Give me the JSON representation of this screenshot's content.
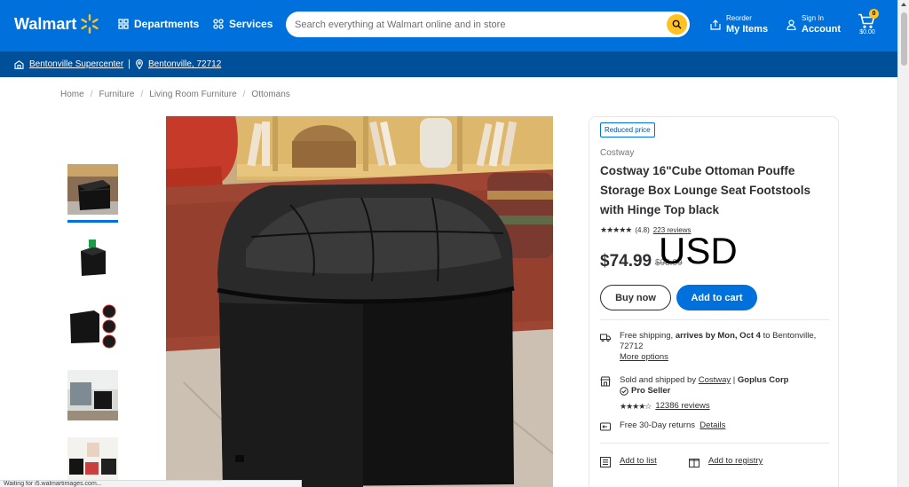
{
  "header": {
    "logo_text": "Walmart",
    "departments": "Departments",
    "services": "Services",
    "search_placeholder": "Search everything at Walmart online and in store",
    "reorder_small": "Reorder",
    "reorder_big": "My Items",
    "signin_small": "Sign In",
    "signin_big": "Account",
    "cart_count": "0",
    "cart_total": "$0.00",
    "colors": {
      "brand_blue": "#0071dc",
      "spark_yellow": "#ffc220",
      "dark_blue": "#004f9a"
    }
  },
  "subbar": {
    "store": "Bentonville Supercenter",
    "location": "Bentonville, 72712"
  },
  "breadcrumb": [
    "Home",
    "Furniture",
    "Living Room Furniture",
    "Ottomans"
  ],
  "product": {
    "badge": "Reduced price",
    "brand": "Costway",
    "title": "Costway 16\"Cube Ottoman Pouffe Storage Box Lounge Seat Footstools with Hinge Top black",
    "rating_value": "(4.8)",
    "review_count": "223 reviews",
    "price": "$74.99",
    "was_price": "$93.99",
    "overlay_text": "USD",
    "buy_now": "Buy now",
    "add_to_cart": "Add to cart"
  },
  "fulfillment": {
    "shipping_prefix": "Free shipping, ",
    "shipping_bold": "arrives by Mon, Oct 4",
    "shipping_suffix": " to Bentonville, 72712",
    "more_options": "More options",
    "sold_prefix": "Sold and shipped by ",
    "seller_link": "Costway",
    "seller_sep": " | ",
    "seller_corp": "Goplus Corp",
    "pro_seller": "Pro Seller",
    "seller_reviews": "12386 reviews",
    "returns": "Free 30-Day returns",
    "returns_details": "Details",
    "add_to_list": "Add to list",
    "add_to_registry": "Add to registry"
  },
  "status_bar": "Waiting for i5.walmartimages.com..."
}
